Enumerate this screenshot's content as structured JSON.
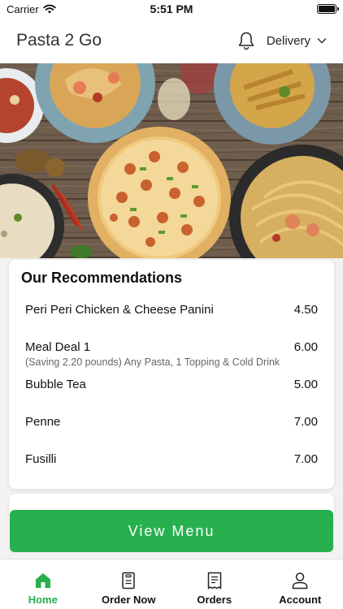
{
  "status_bar": {
    "carrier": "Carrier",
    "time": "5:51 PM"
  },
  "header": {
    "title": "Pasta 2 Go",
    "delivery_label": "Delivery"
  },
  "recommendations": {
    "title": "Our Recommendations",
    "items": [
      {
        "name": "Peri Peri Chicken & Cheese Panini",
        "price": "4.50",
        "desc": ""
      },
      {
        "name": "Meal Deal 1",
        "price": "6.00",
        "desc": "(Saving 2.20 pounds) Any Pasta, 1 Topping & Cold Drink"
      },
      {
        "name": "Bubble Tea",
        "price": "5.00",
        "desc": ""
      },
      {
        "name": "Penne",
        "price": "7.00",
        "desc": ""
      },
      {
        "name": "Fusilli",
        "price": "7.00",
        "desc": ""
      }
    ]
  },
  "view_menu_label": "View Menu",
  "tabs": [
    {
      "label": "Home",
      "icon": "home-icon",
      "active": true
    },
    {
      "label": "Order Now",
      "icon": "order-now-icon",
      "active": false
    },
    {
      "label": "Orders",
      "icon": "receipt-icon",
      "active": false
    },
    {
      "label": "Account",
      "icon": "user-icon",
      "active": false
    }
  ],
  "colors": {
    "accent": "#27b04e",
    "background": "#f2f2f2"
  }
}
